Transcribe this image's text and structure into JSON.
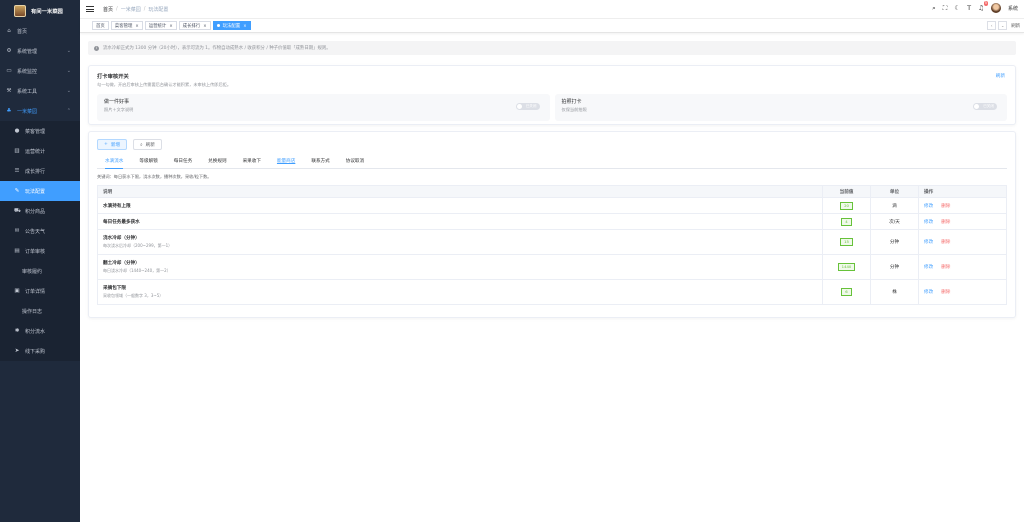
{
  "brand": {
    "title": "有间一米菜园"
  },
  "sidebar": {
    "items": [
      {
        "label": "首页",
        "icon": "home-icon"
      },
      {
        "label": "系统管理",
        "icon": "gear-icon"
      },
      {
        "label": "系统监控",
        "icon": "monitor-icon"
      },
      {
        "label": "系统工具",
        "icon": "tool-icon"
      },
      {
        "label": "一米菜园",
        "icon": "sprout-icon"
      }
    ],
    "sub_items": [
      {
        "label": "菜客管理",
        "icon": "user-icon"
      },
      {
        "label": "运营统计",
        "icon": "chart-icon"
      },
      {
        "label": "成长排行",
        "icon": "list-icon"
      },
      {
        "label": "玩法配置",
        "icon": "edit-icon"
      },
      {
        "label": "积分商品",
        "icon": "cart-icon"
      },
      {
        "label": "公告天气",
        "icon": "chat-icon"
      },
      {
        "label": "订单审核",
        "icon": "doc-icon"
      },
      {
        "label": "审核履约",
        "icon": ""
      },
      {
        "label": "订单详情",
        "icon": "clipboard-icon"
      },
      {
        "label": "操作日志",
        "icon": ""
      },
      {
        "label": "积分流水",
        "icon": "star-icon"
      },
      {
        "label": "线下采购",
        "icon": "send-icon"
      }
    ]
  },
  "header": {
    "crumbs": [
      "首页",
      "一米菜园",
      "玩法配置"
    ],
    "user": "系统",
    "notif_count": "5"
  },
  "tags": {
    "items": [
      "首页",
      "菜客管理",
      "运营统计",
      "成长排行",
      "玩法配置"
    ],
    "refresh_label": "刷新"
  },
  "notice": "流水冷却正式为 1300 分钟（20小时），表示可流为 1。作物自动成熟水 / 收获积分 / 种子价值取「成熟日期」规则。",
  "card1": {
    "title": "打卡审核开关",
    "desc": "勾一勾做，开启后审核上传需要后台确认才能积累，未审核上传即后拒。",
    "reset": "刷新",
    "switch1": {
      "title": "做一件好事",
      "desc": "照片＋文字说明",
      "state": "已关闭"
    },
    "switch2": {
      "title": "拍照打卡",
      "desc": "仅保当前拍照",
      "state": "已关闭"
    }
  },
  "card2": {
    "add_label": "新增",
    "search_label": "刷新",
    "tabs": [
      "水滴流水",
      "等级解锁",
      "每日任务",
      "兑换规则",
      "采果收下",
      "能量商店",
      "联系方式",
      "协议取消"
    ],
    "active_tab": 0,
    "link_tab": 5,
    "hint": "关键词：每日获水下限，浇水次数，播种次数，采收/粒下数。",
    "columns": [
      "说明",
      "当前值",
      "单位",
      "操作"
    ],
    "rows": [
      {
        "name": "水滴持有上限",
        "desc": "",
        "value": "20",
        "unit": "滴",
        "tall": false
      },
      {
        "name": "每日任务最多获水",
        "desc": "",
        "value": "4",
        "unit": "次/天",
        "tall": false
      },
      {
        "name": "浇水冷却（分钟）",
        "desc": "每次浇水后冷却（200~299，第一1）",
        "value": "15",
        "unit": "分钟",
        "tall": true
      },
      {
        "name": "翻土冷却（分钟）",
        "desc": "每日浇水冷却（1440~240，第一2）",
        "value": "1440",
        "unit": "分钟",
        "tall": true
      },
      {
        "name": "采摘包下限",
        "desc": "采收包领域（一般数字 3，3~5）",
        "value": "6",
        "unit": "株",
        "tall": true
      }
    ],
    "edit_label": "修改",
    "delete_label": "删除"
  }
}
